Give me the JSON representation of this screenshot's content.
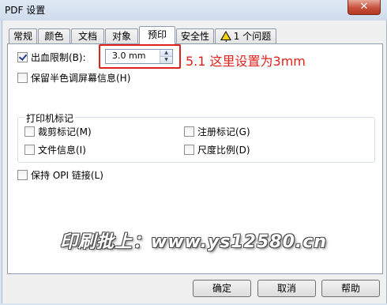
{
  "window": {
    "title": "PDF 设置",
    "close_label": "✕"
  },
  "tabs": [
    {
      "label": "常规"
    },
    {
      "label": "颜色"
    },
    {
      "label": "文档"
    },
    {
      "label": "对象"
    },
    {
      "label": "预印",
      "active": true
    },
    {
      "label": "安全性"
    },
    {
      "label": "1 个问题",
      "icon": "warning-icon"
    }
  ],
  "prepress": {
    "bleed_limit": {
      "label": "出血限制(B):",
      "checked": true,
      "value": "3.0 mm"
    },
    "keep_halftone": {
      "label": "保留半色调屏幕信息(H)",
      "checked": false
    },
    "printer_marks": {
      "title": "打印机标记",
      "crop_marks": {
        "label": "裁剪标记(M)",
        "checked": false
      },
      "registration_marks": {
        "label": "注册标记(G)",
        "checked": false
      },
      "file_info": {
        "label": "文件信息(I)",
        "checked": false
      },
      "densitometer_scale": {
        "label": "尺度比例(D)",
        "checked": false
      }
    },
    "keep_opi": {
      "label": "保持 OPI 链接(L)",
      "checked": false
    }
  },
  "annotation": {
    "text": "5.1 这里设置为3mm"
  },
  "watermark": {
    "text": "印刷批上：www.ys12580.cn"
  },
  "buttons": {
    "ok": "确定",
    "cancel": "取消",
    "help": "帮助"
  },
  "colors": {
    "annotation": "#e0221d",
    "titlebar": "#dfe9f5",
    "close": "#c7503b"
  }
}
